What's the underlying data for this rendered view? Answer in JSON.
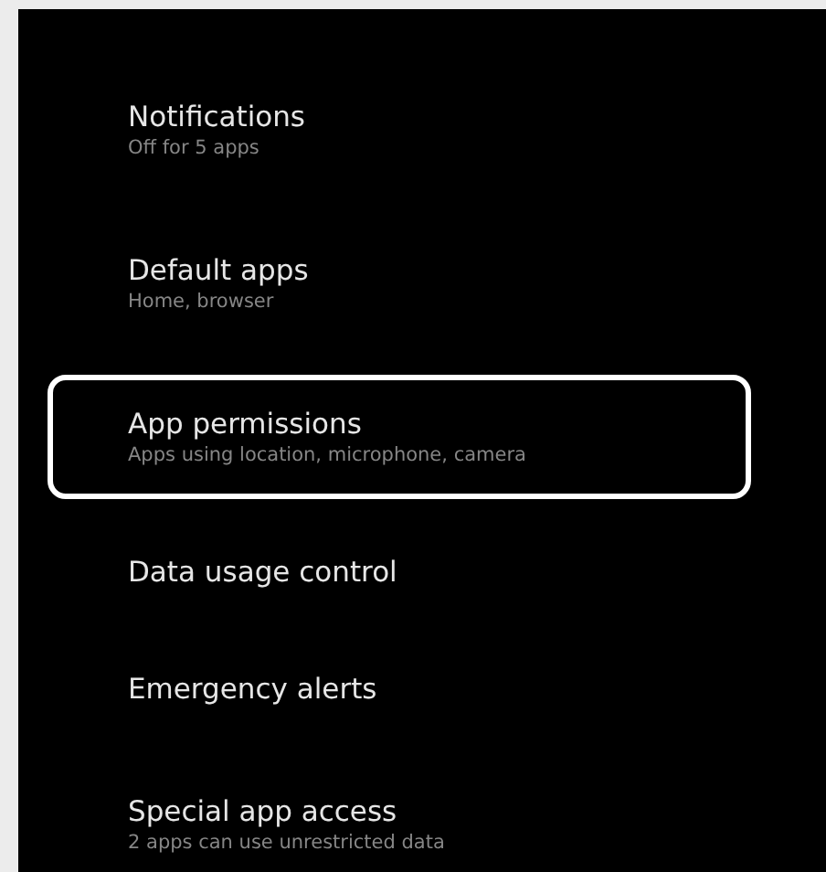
{
  "items": [
    {
      "title": "Notifications",
      "subtitle": "Off for 5 apps",
      "highlighted": false
    },
    {
      "title": "Default apps",
      "subtitle": "Home, browser",
      "highlighted": false
    },
    {
      "title": "App permissions",
      "subtitle": "Apps using location, microphone, camera",
      "highlighted": true
    },
    {
      "title": "Data usage control",
      "highlighted": false
    },
    {
      "title": "Emergency alerts",
      "highlighted": false
    },
    {
      "title": "Special app access",
      "subtitle": "2 apps can use unrestricted data",
      "highlighted": false
    }
  ]
}
